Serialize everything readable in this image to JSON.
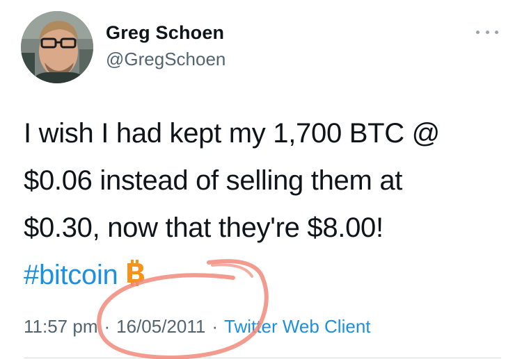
{
  "author": {
    "display_name": "Greg Schoen",
    "handle": "@GregSchoen"
  },
  "tweet": {
    "lines": [
      "I wish I had kept my 1,700 BTC @",
      "$0.06 instead of selling them at",
      "$0.30, now that they're $8.00!"
    ],
    "hashtag": "#bitcoin",
    "hashtag_emoji_icon": "bitcoin-icon"
  },
  "meta": {
    "time": "11:57 pm",
    "separator": "·",
    "date": "16/05/2011",
    "client": "Twitter Web Client"
  },
  "colors": {
    "link": "#1d8fe0",
    "secondary_text": "#536471",
    "bitcoin": "#f7931a",
    "annotation_circle": "#f08a7a"
  }
}
